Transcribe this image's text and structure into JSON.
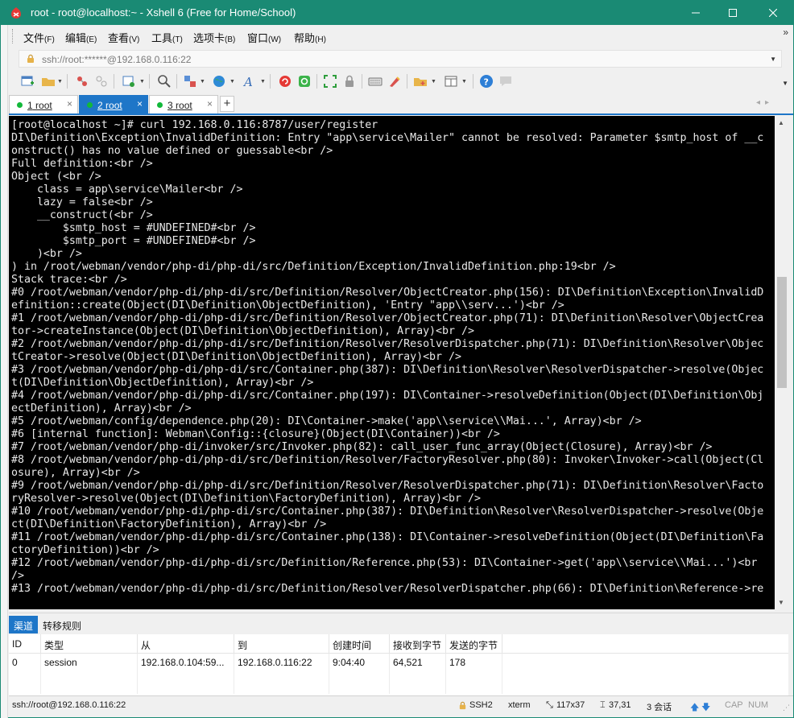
{
  "window": {
    "title": "root - root@localhost:~ - Xshell 6 (Free for Home/School)"
  },
  "menu": {
    "items": [
      {
        "label": "文件",
        "key": "(F)"
      },
      {
        "label": "编辑",
        "key": "(E)"
      },
      {
        "label": "查看",
        "key": "(V)"
      },
      {
        "label": "工具",
        "key": "(T)"
      },
      {
        "label": "选项卡",
        "key": "(B)"
      },
      {
        "label": "窗口",
        "key": "(W)"
      },
      {
        "label": "帮助",
        "key": "(H)"
      }
    ]
  },
  "address": {
    "value": "ssh://root:******@192.168.0.116:22"
  },
  "toolbar": {
    "icons": [
      "new-session-icon",
      "open-folder-icon",
      "disconnect-icon",
      "reconnect-icon",
      "properties-icon",
      "find-icon",
      "transfer-icon",
      "globe-icon",
      "font-icon",
      "xftp-icon",
      "xshell-green-icon",
      "fullscreen-icon",
      "lock-icon",
      "keyboard-icon",
      "highlight-icon",
      "add-folder-icon",
      "layout-icon",
      "help-icon",
      "chat-icon"
    ]
  },
  "tabs": [
    {
      "num": "1",
      "label": " root",
      "active": false
    },
    {
      "num": "2",
      "label": " root",
      "active": true
    },
    {
      "num": "3",
      "label": " root",
      "active": false
    }
  ],
  "terminal": {
    "lines": [
      "[root@localhost ~]# curl 192.168.0.116:8787/user/register",
      "DI\\Definition\\Exception\\InvalidDefinition: Entry \"app\\service\\Mailer\" cannot be resolved: Parameter $smtp_host of __c",
      "onstruct() has no value defined or guessable<br />",
      "Full definition:<br />",
      "Object (<br />",
      "    class = app\\service\\Mailer<br />",
      "    lazy = false<br />",
      "    __construct(<br />",
      "        $smtp_host = #UNDEFINED#<br />",
      "        $smtp_port = #UNDEFINED#<br />",
      "    )<br />",
      ") in /root/webman/vendor/php-di/php-di/src/Definition/Exception/InvalidDefinition.php:19<br />",
      "Stack trace:<br />",
      "#0 /root/webman/vendor/php-di/php-di/src/Definition/Resolver/ObjectCreator.php(156): DI\\Definition\\Exception\\InvalidD",
      "efinition::create(Object(DI\\Definition\\ObjectDefinition), 'Entry \"app\\\\serv...')<br />",
      "#1 /root/webman/vendor/php-di/php-di/src/Definition/Resolver/ObjectCreator.php(71): DI\\Definition\\Resolver\\ObjectCrea",
      "tor->createInstance(Object(DI\\Definition\\ObjectDefinition), Array)<br />",
      "#2 /root/webman/vendor/php-di/php-di/src/Definition/Resolver/ResolverDispatcher.php(71): DI\\Definition\\Resolver\\Objec",
      "tCreator->resolve(Object(DI\\Definition\\ObjectDefinition), Array)<br />",
      "#3 /root/webman/vendor/php-di/php-di/src/Container.php(387): DI\\Definition\\Resolver\\ResolverDispatcher->resolve(Objec",
      "t(DI\\Definition\\ObjectDefinition), Array)<br />",
      "#4 /root/webman/vendor/php-di/php-di/src/Container.php(197): DI\\Container->resolveDefinition(Object(DI\\Definition\\Obj",
      "ectDefinition), Array)<br />",
      "#5 /root/webman/config/dependence.php(20): DI\\Container->make('app\\\\service\\\\Mai...', Array)<br />",
      "#6 [internal function]: Webman\\Config::{closure}(Object(DI\\Container))<br />",
      "#7 /root/webman/vendor/php-di/invoker/src/Invoker.php(82): call_user_func_array(Object(Closure), Array)<br />",
      "#8 /root/webman/vendor/php-di/php-di/src/Definition/Resolver/FactoryResolver.php(80): Invoker\\Invoker->call(Object(Cl",
      "osure), Array)<br />",
      "#9 /root/webman/vendor/php-di/php-di/src/Definition/Resolver/ResolverDispatcher.php(71): DI\\Definition\\Resolver\\Facto",
      "ryResolver->resolve(Object(DI\\Definition\\FactoryDefinition), Array)<br />",
      "#10 /root/webman/vendor/php-di/php-di/src/Container.php(387): DI\\Definition\\Resolver\\ResolverDispatcher->resolve(Obje",
      "ct(DI\\Definition\\FactoryDefinition), Array)<br />",
      "#11 /root/webman/vendor/php-di/php-di/src/Container.php(138): DI\\Container->resolveDefinition(Object(DI\\Definition\\Fa",
      "ctoryDefinition))<br />",
      "#12 /root/webman/vendor/php-di/php-di/src/Definition/Reference.php(53): DI\\Container->get('app\\\\service\\\\Mai...')<br",
      "/>",
      "#13 /root/webman/vendor/php-di/php-di/src/Definition/Resolver/ResolverDispatcher.php(66): DI\\Definition\\Reference->re"
    ]
  },
  "panel": {
    "tabs": [
      "渠道",
      "转移规则"
    ],
    "columns": [
      "ID",
      "类型",
      "从",
      "到",
      "创建时间",
      "接收到字节",
      "发送的字节"
    ],
    "rows": [
      [
        "0",
        "session",
        "192.168.0.104:59...",
        "192.168.0.116:22",
        "9:04:40",
        "64,521",
        "178"
      ]
    ]
  },
  "status": {
    "connection": "ssh://root@192.168.0.116:22",
    "protocol": "SSH2",
    "term": "xterm",
    "size": "117x37",
    "cursor": "37,31",
    "sessions": "3 会话",
    "cap": "CAP",
    "num": "NUM"
  },
  "colors": {
    "titlebar": "#1a8a74",
    "tab_active": "#1e76c8",
    "terminal_bg": "#000000",
    "terminal_fg": "#e8e8e8"
  }
}
